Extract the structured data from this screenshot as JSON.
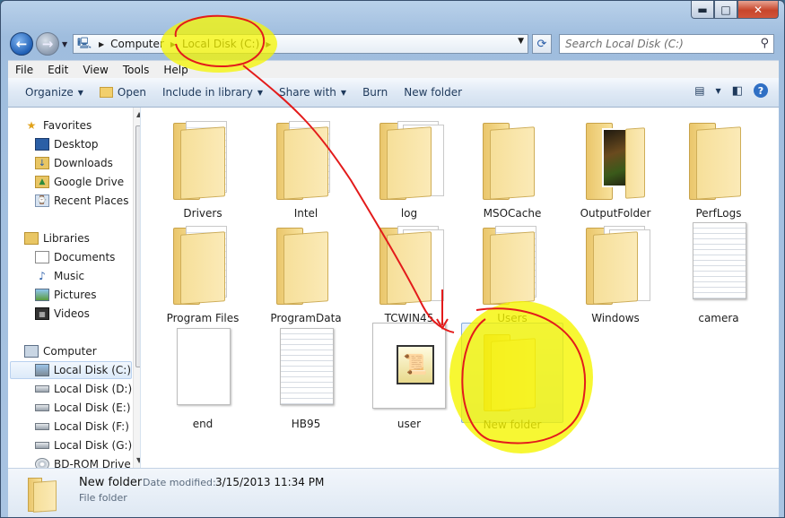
{
  "window": {
    "minimize": "▬",
    "maximize": "□",
    "close": "✕"
  },
  "address": {
    "crumbs": [
      "Computer",
      "Local Disk (C:)"
    ],
    "search_placeholder": "Search Local Disk (C:)"
  },
  "menu": [
    "File",
    "Edit",
    "View",
    "Tools",
    "Help"
  ],
  "toolbar": {
    "organize": "Organize",
    "open": "Open",
    "include": "Include in library",
    "share": "Share with",
    "burn": "Burn",
    "new_folder": "New folder"
  },
  "nav": {
    "favorites": "Favorites",
    "fav_items": [
      "Desktop",
      "Downloads",
      "Google Drive",
      "Recent Places"
    ],
    "libraries": "Libraries",
    "lib_items": [
      "Documents",
      "Music",
      "Pictures",
      "Videos"
    ],
    "computer": "Computer",
    "drives": [
      "Local Disk (C:)",
      "Local Disk (D:)",
      "Local Disk (E:)",
      "Local Disk (F:)",
      "Local Disk (G:)",
      "BD-ROM Drive"
    ]
  },
  "items": [
    {
      "label": "Drivers",
      "kind": "folder-docs"
    },
    {
      "label": "Intel",
      "kind": "folder-docs"
    },
    {
      "label": "log",
      "kind": "folder-paper"
    },
    {
      "label": "MSOCache",
      "kind": "folder-empty"
    },
    {
      "label": "OutputFolder",
      "kind": "folder-photo"
    },
    {
      "label": "PerfLogs",
      "kind": "folder-empty"
    },
    {
      "label": "Program Files",
      "kind": "folder-docs"
    },
    {
      "label": "ProgramData",
      "kind": "folder-empty"
    },
    {
      "label": "TCWIN45",
      "kind": "folder-paper"
    },
    {
      "label": "Users",
      "kind": "folder-docs"
    },
    {
      "label": "Windows",
      "kind": "folder-paper"
    },
    {
      "label": "camera",
      "kind": "doc-lined"
    },
    {
      "label": "end",
      "kind": "doc"
    },
    {
      "label": "HB95",
      "kind": "doc-lined"
    },
    {
      "label": "user",
      "kind": "app"
    },
    {
      "label": "New folder",
      "kind": "folder-empty",
      "selected": true
    }
  ],
  "details": {
    "name": "New folder",
    "modified_label": "Date modified:",
    "modified": "3/15/2013 11:34 PM",
    "type": "File folder"
  },
  "colors": {
    "highlight": "#f5f500",
    "annotation": "#e31b1b",
    "folder": "#f3d98a",
    "selection": "#c9dff7"
  }
}
